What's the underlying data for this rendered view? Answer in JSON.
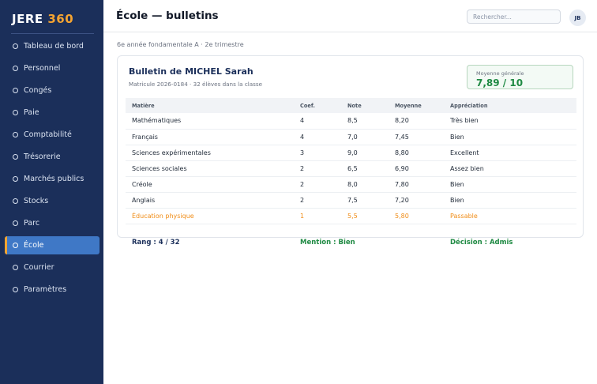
{
  "sidebar": {
    "brand_prefix": "JERE",
    "brand_accent": "360",
    "items": [
      {
        "label": "Tableau de bord"
      },
      {
        "label": "Personnel"
      },
      {
        "label": "Congés"
      },
      {
        "label": "Paie"
      },
      {
        "label": "Comptabilité"
      },
      {
        "label": "Trésorerie"
      },
      {
        "label": "Marchés publics"
      },
      {
        "label": "Stocks"
      },
      {
        "label": "Parc"
      },
      {
        "label": "École"
      },
      {
        "label": "Courrier"
      },
      {
        "label": "Paramètres"
      }
    ],
    "active_item": "École"
  },
  "header": {
    "title": "École — bulletins",
    "search_placeholder": "Rechercher...",
    "avatar_initials": "JB"
  },
  "main": {
    "subtitle": "6e année fondamentale A · 2e trimestre",
    "student": {
      "name": "Bulletin de MICHEL Sarah",
      "meta": "Matricule 2026-0184 · 32 élèves dans la classe"
    },
    "average": {
      "label": "Moyenne générale",
      "value": "7,89 / 10"
    },
    "table": {
      "headers": [
        "Matière",
        "Coef.",
        "Note",
        "Moyenne",
        "Appréciation"
      ],
      "rows": [
        {
          "subject": "Mathématiques",
          "coef": "4",
          "note": "8,5",
          "average": "8,20",
          "appreciation": "Très bien",
          "warn": false
        },
        {
          "subject": "Français",
          "coef": "4",
          "note": "7,0",
          "average": "7,45",
          "appreciation": "Bien",
          "warn": false
        },
        {
          "subject": "Sciences expérimentales",
          "coef": "3",
          "note": "9,0",
          "average": "8,80",
          "appreciation": "Excellent",
          "warn": false
        },
        {
          "subject": "Sciences sociales",
          "coef": "2",
          "note": "6,5",
          "average": "6,90",
          "appreciation": "Assez bien",
          "warn": false
        },
        {
          "subject": "Créole",
          "coef": "2",
          "note": "8,0",
          "average": "7,80",
          "appreciation": "Bien",
          "warn": false
        },
        {
          "subject": "Anglais",
          "coef": "2",
          "note": "7,5",
          "average": "7,20",
          "appreciation": "Bien",
          "warn": false
        },
        {
          "subject": "Éducation physique",
          "coef": "1",
          "note": "5,5",
          "average": "5,80",
          "appreciation": "Passable",
          "warn": true
        }
      ]
    },
    "footer": {
      "rank": "Rang : 4 / 32",
      "mention": "Mention : Bien",
      "decision": "Décision : Admis"
    }
  },
  "colors": {
    "sidebar_bg": "#1b2f5a",
    "accent_orange": "#f5a431",
    "active_blue": "#3f78c6",
    "success_green": "#1f8a43",
    "warning_orange": "#f08c16"
  }
}
